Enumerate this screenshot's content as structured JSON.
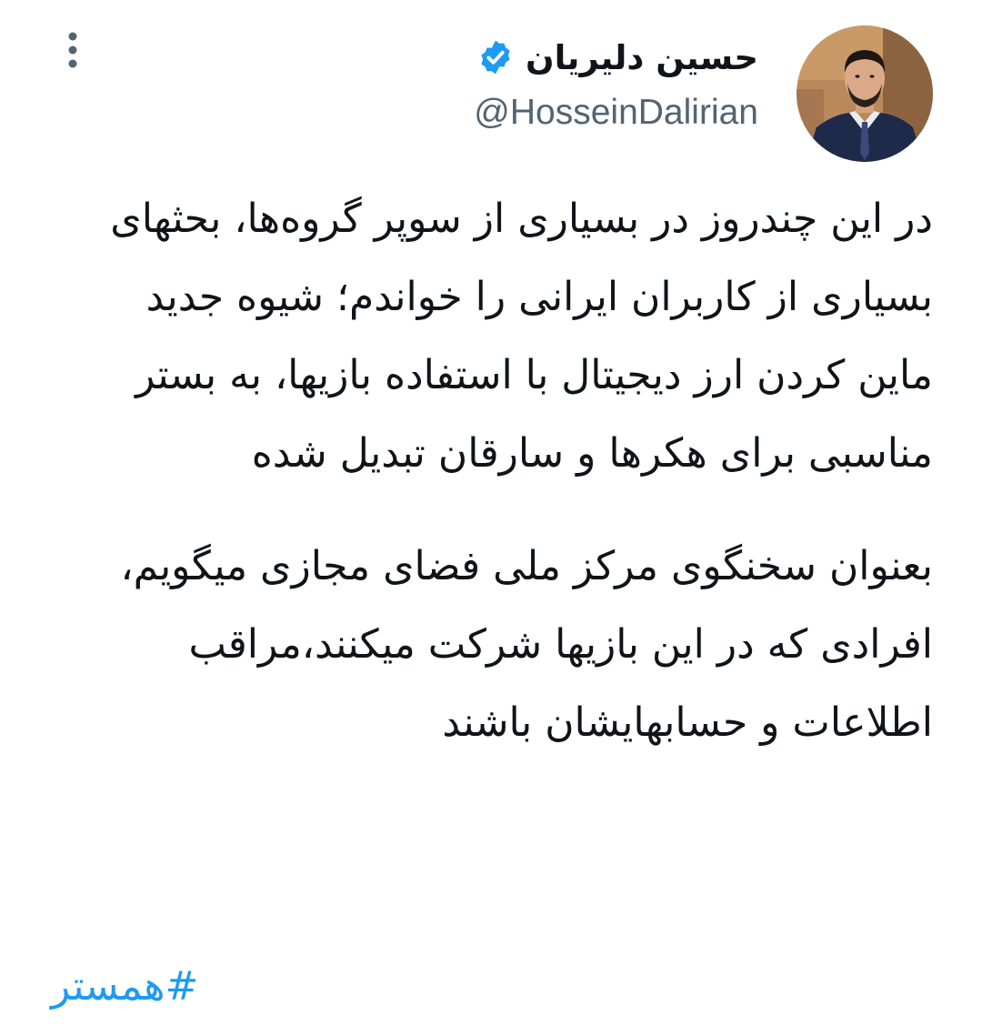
{
  "author": {
    "display_name": "حسین دلیریان",
    "handle": "@HosseinDalirian",
    "verified": true,
    "avatar_icon": "profile-photo"
  },
  "menu": {
    "more_icon": "vertical-ellipsis-icon"
  },
  "tweet": {
    "paragraph_1": "در این چندروز در بسیاری از سوپر گروه‌ها، بحثهای بسیاری از کاربران ایرانی را خواندم؛ شیوه جدید ماین کردن ارز دیجیتال با استفاده بازیها، به بستر مناسبی برای هکرها و سارقان تبدیل شده",
    "paragraph_2": "بعنوان سخنگوی مرکز ملی فضای مجازی میگویم، افرادی که در این بازیها شرکت میکنند،مراقب اطلاعات و حسابهایشان باشند",
    "hashtag": "#همستر"
  },
  "colors": {
    "verified_badge": "#1d9bf0",
    "hashtag": "#1d9bf0",
    "handle": "#536471",
    "text": "#0f1419",
    "background": "#ffffff"
  }
}
